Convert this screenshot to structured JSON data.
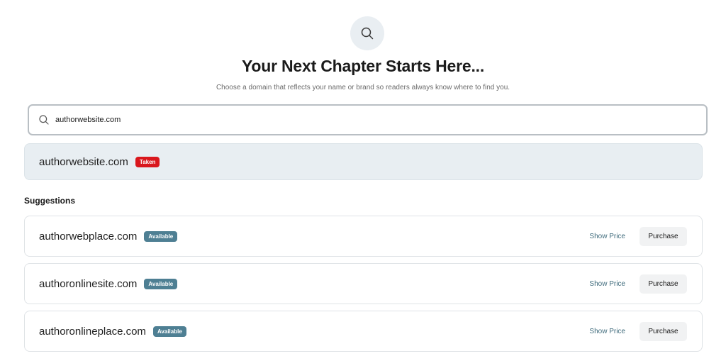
{
  "header": {
    "icon": "search-icon",
    "title": "Your Next Chapter Starts Here...",
    "subtitle": "Choose a domain that reflects your name or brand so readers always know where to find you."
  },
  "search": {
    "icon": "search-icon",
    "value": "authorwebsite.com"
  },
  "result": {
    "domain": "authorwebsite.com",
    "status": "Taken"
  },
  "suggestions": {
    "label": "Suggestions",
    "items": [
      {
        "domain": "authorwebplace.com",
        "status": "Available",
        "show_price": "Show Price",
        "purchase": "Purchase"
      },
      {
        "domain": "authoronlinesite.com",
        "status": "Available",
        "show_price": "Show Price",
        "purchase": "Purchase"
      },
      {
        "domain": "authoronlineplace.com",
        "status": "Available",
        "show_price": "Show Price",
        "purchase": "Purchase"
      }
    ]
  },
  "colors": {
    "taken_badge": "#d9171d",
    "available_badge": "#4e7f93",
    "link": "#3f6b7c"
  }
}
